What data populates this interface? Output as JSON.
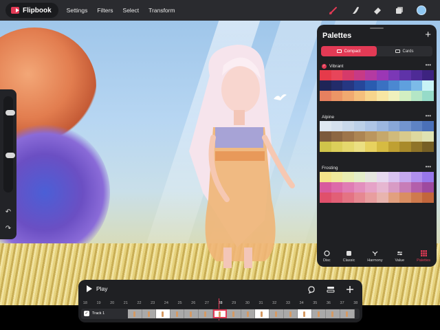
{
  "app": {
    "name": "Flipbook"
  },
  "menu": [
    "Settings",
    "Filters",
    "Select",
    "Transform"
  ],
  "toolbar": {
    "tools": [
      "brush-icon",
      "smudge-icon",
      "eraser-icon",
      "layers-icon",
      "color-icon"
    ],
    "current_color": "#8ec7f2"
  },
  "rail": {
    "icons": [
      "undo-icon",
      "redo-icon"
    ]
  },
  "palettes": {
    "title": "Palettes",
    "view_tabs": [
      "Compact",
      "Cards"
    ],
    "active_view": "Compact",
    "sections": [
      {
        "name": "Vibrant",
        "selected": true,
        "colors": [
          "#e63a4a",
          "#e8455a",
          "#d53a6a",
          "#c73a86",
          "#b43aa2",
          "#9b37b5",
          "#7b38b6",
          "#5f33a8",
          "#4e2b96",
          "#3d2380",
          "#1f2557",
          "#232c6a",
          "#263782",
          "#26479a",
          "#2a5cb0",
          "#3a71c2",
          "#4b88d1",
          "#5fa0de",
          "#7cbbe8",
          "#c8f3f6",
          "#e7805f",
          "#ec9566",
          "#f0a970",
          "#f4bf7c",
          "#f7d58c",
          "#f8e6a3",
          "#f0f1bd",
          "#d2efc2",
          "#b4e6c6",
          "#96dbc9"
        ]
      },
      {
        "name": "Alpine",
        "selected": false,
        "colors": [
          "#dfe8f1",
          "#d6e1ee",
          "#c9d8ea",
          "#bcd0e8",
          "#aec5e6",
          "#9cb7e0",
          "#88a7d8",
          "#7395cf",
          "#5e83c4",
          "#4a70b8",
          "#7c5a3c",
          "#8d6742",
          "#9e754a",
          "#ad8553",
          "#bb965e",
          "#c6a86b",
          "#d0ba7b",
          "#d8ca8c",
          "#ddd89f",
          "#dfe2b2",
          "#cfc44a",
          "#dccf5a",
          "#e5d86d",
          "#ebdf82",
          "#e7d15f",
          "#d6bb42",
          "#bfa032",
          "#a88a2b",
          "#8f7428",
          "#765f25"
        ]
      },
      {
        "name": "Frosting",
        "selected": false,
        "colors": [
          "#f4e48a",
          "#f0ea9d",
          "#e9edb2",
          "#e4eec9",
          "#e5e6df",
          "#e6d9ef",
          "#d9c3f0",
          "#c6a9ef",
          "#b090ee",
          "#9877ea",
          "#d85a9e",
          "#dd6aa9",
          "#e07cb4",
          "#e38fbe",
          "#e6a3c8",
          "#e6b7d1",
          "#d89bc5",
          "#c77db8",
          "#b35fab",
          "#9e4a9f",
          "#e0506b",
          "#e25f76",
          "#e47383",
          "#e68891",
          "#e89e9f",
          "#e8b4ae",
          "#e2a07f",
          "#da8e62",
          "#cf7a4d",
          "#c2663c"
        ]
      }
    ],
    "bottom_tabs": [
      {
        "label": "Disc",
        "icon": "disc-icon"
      },
      {
        "label": "Classic",
        "icon": "classic-icon"
      },
      {
        "label": "Harmony",
        "icon": "harmony-icon"
      },
      {
        "label": "Value",
        "icon": "value-icon"
      },
      {
        "label": "Palettes",
        "icon": "palettes-grid-icon",
        "active": true
      }
    ]
  },
  "timeline": {
    "play_label": "Play",
    "frame_numbers": [
      "18",
      "19",
      "20",
      "21",
      "22",
      "23",
      "24",
      "25",
      "26",
      "27",
      "28",
      "29",
      "30",
      "31",
      "32",
      "33",
      "34",
      "35",
      "36",
      "37",
      "38"
    ],
    "current_frame": "28",
    "track_name": "Track 1",
    "track_enabled": true
  }
}
